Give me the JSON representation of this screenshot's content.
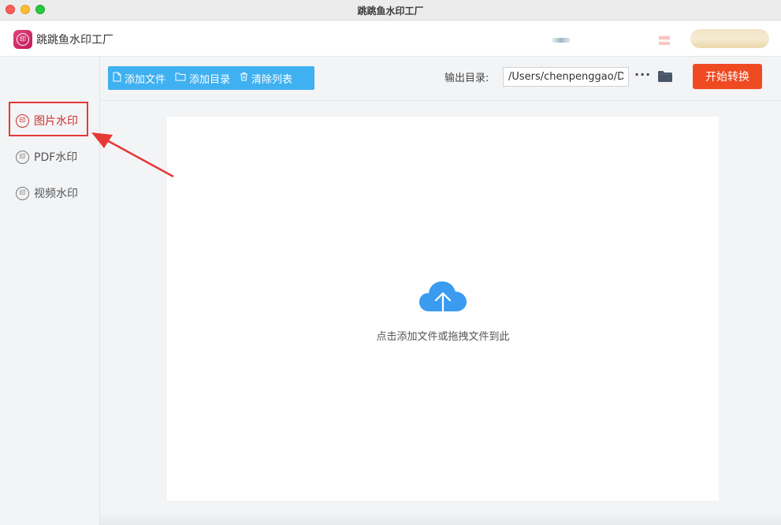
{
  "window": {
    "title": "跳跳鱼水印工厂"
  },
  "header": {
    "app_name": "跳跳鱼水印工厂",
    "logo_text": "印"
  },
  "sidebar": {
    "items": [
      {
        "label": "图片水印",
        "icon": "印",
        "active": true
      },
      {
        "label": "PDF水印",
        "icon": "印",
        "active": false
      },
      {
        "label": "视频水印",
        "icon": "印",
        "active": false
      }
    ]
  },
  "toolbar": {
    "add_file": "添加文件",
    "add_dir": "添加目录",
    "clear_list": "清除列表",
    "output_label": "输出目录:",
    "output_path": "/Users/chenpenggao/D",
    "more": "···",
    "start": "开始转换"
  },
  "dropzone": {
    "hint": "点击添加文件或拖拽文件到此"
  },
  "colors": {
    "primary_blue": "#3fb0f0",
    "start_orange": "#ef4a22",
    "active_red": "#c9302c",
    "annotation_red": "#e53935",
    "cloud_blue": "#3a9bf0"
  }
}
